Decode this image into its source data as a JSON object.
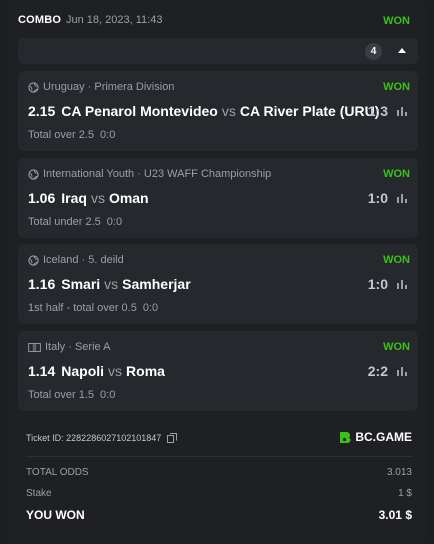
{
  "header": {
    "combo_label": "COMBO",
    "date": "Jun 18, 2023, 11:43",
    "status": "WON",
    "bets_count": "4"
  },
  "bets": [
    {
      "league_icon": "globe-icon",
      "league": "Uruguay · Primera Division",
      "status": "WON",
      "odds": "2.15",
      "home": "CA Penarol Montevideo",
      "vs": "vs",
      "away": "CA River Plate (URU)",
      "score": "1:3",
      "market": "Total over 2.5",
      "selection": "0:0"
    },
    {
      "league_icon": "globe-icon",
      "league": "International Youth · U23 WAFF Championship",
      "status": "WON",
      "odds": "1.06",
      "home": "Iraq",
      "vs": "vs",
      "away": "Oman",
      "score": "1:0",
      "market": "Total under 2.5",
      "selection": "0:0"
    },
    {
      "league_icon": "globe-icon",
      "league": "Iceland · 5. deild",
      "status": "WON",
      "odds": "1.16",
      "home": "Smari",
      "vs": "vs",
      "away": "Samherjar",
      "score": "1:0",
      "market": "1st half - total over 0.5",
      "selection": "0:0"
    },
    {
      "league_icon": "flag-icon",
      "league": "Italy · Serie A",
      "status": "WON",
      "odds": "1.14",
      "home": "Napoli",
      "vs": "vs",
      "away": "Roma",
      "score": "2:2",
      "market": "Total over 1.5",
      "selection": "0:0"
    }
  ],
  "ticket": {
    "label": "Ticket ID: 2282286027102101847",
    "brand": "BC.GAME"
  },
  "summary": {
    "total_odds_label": "TOTAL ODDS",
    "total_odds": "3.013",
    "stake_label": "Stake",
    "stake": "1 $",
    "won_label": "YOU WON",
    "won": "3.01 $"
  },
  "colors": {
    "accent_green": "#3bc117",
    "background": "#1e2024",
    "panel": "#25282c"
  }
}
